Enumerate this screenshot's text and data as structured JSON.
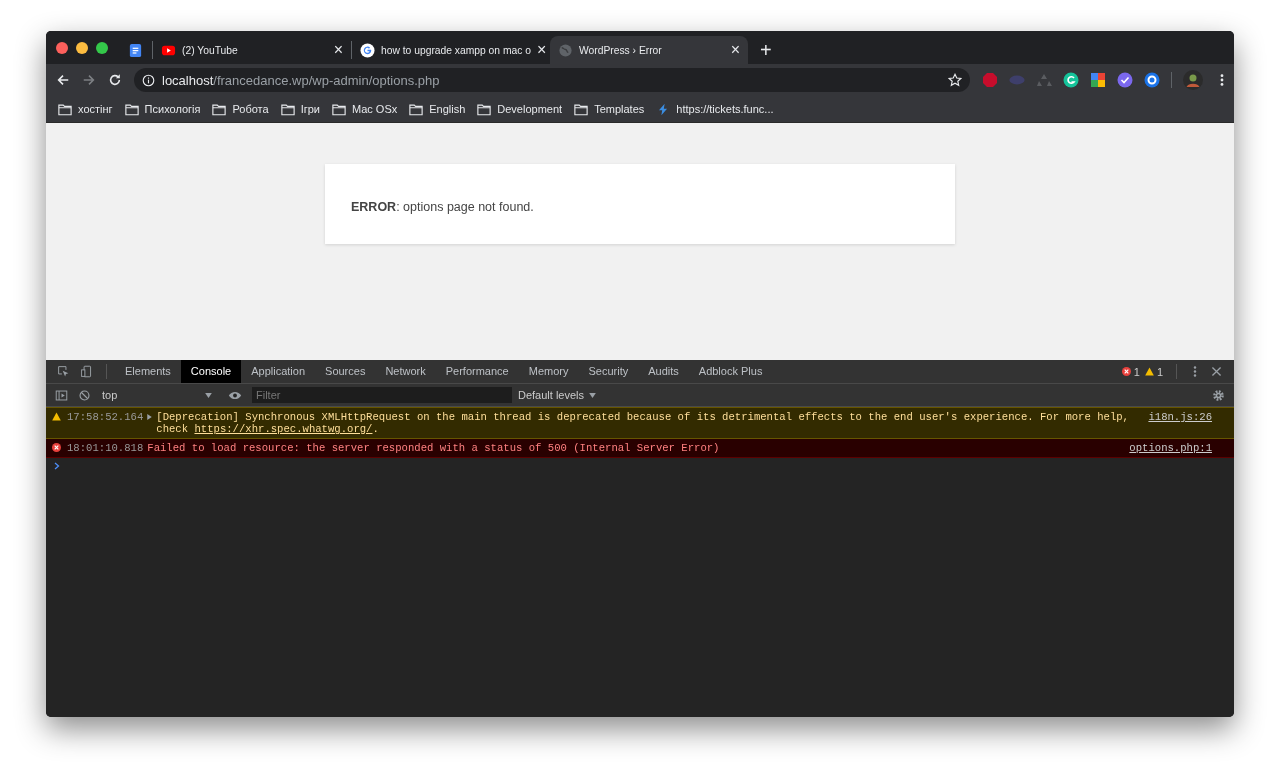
{
  "browser": {
    "tabs": [
      {
        "kind": "docs",
        "pinned": true,
        "selected": false
      },
      {
        "kind": "youtube",
        "pinned": false,
        "title": "(2) YouTube",
        "close": "×",
        "selected": false
      },
      {
        "kind": "google",
        "pinned": false,
        "title": "how to upgrade xampp on mac o",
        "close": "×",
        "selected": false
      },
      {
        "kind": "globe",
        "pinned": false,
        "title": "WordPress › Error",
        "close": "×",
        "selected": true
      }
    ],
    "new_tab": "+",
    "address": {
      "host": "localhost",
      "path": "/francedance.wp/wp-admin/options.php"
    },
    "bookmarks": [
      {
        "kind": "folder",
        "label": "хостінг"
      },
      {
        "kind": "folder",
        "label": "Психологія"
      },
      {
        "kind": "folder",
        "label": "Робота"
      },
      {
        "kind": "folder",
        "label": "Ігри"
      },
      {
        "kind": "folder",
        "label": "Mac OSx"
      },
      {
        "kind": "folder",
        "label": "English"
      },
      {
        "kind": "folder",
        "label": "Development"
      },
      {
        "kind": "folder",
        "label": "Templates"
      },
      {
        "kind": "link",
        "label": "https://tickets.func..."
      }
    ]
  },
  "page": {
    "message": "**ERROR**: options page not found."
  },
  "devtools": {
    "tabs": [
      {
        "label": "Elements",
        "selected": false
      },
      {
        "label": "Console",
        "selected": true
      },
      {
        "label": "Application",
        "selected": false
      },
      {
        "label": "Sources",
        "selected": false
      },
      {
        "label": "Network",
        "selected": false
      },
      {
        "label": "Performance",
        "selected": false
      },
      {
        "label": "Memory",
        "selected": false
      },
      {
        "label": "Security",
        "selected": false
      },
      {
        "label": "Audits",
        "selected": false
      },
      {
        "label": "Adblock Plus",
        "selected": false
      }
    ],
    "error_count": "1",
    "warning_count": "1",
    "context": "top",
    "filter": {
      "placeholder": "Filter"
    },
    "levels": "Default levels",
    "messages": [
      {
        "kind": "warning",
        "time": "17:58:52.164",
        "expandable": true,
        "text": "[Deprecation] Synchronous XMLHttpRequest on the main thread is deprecated because of its detrimental effects to the end user's experience. For more help, check ",
        "link": "https://xhr.spec.whatwg.org/",
        "after": ".",
        "source": "i18n.js:26"
      },
      {
        "kind": "error",
        "time": "18:01:10.818",
        "expandable": false,
        "text": "Failed to load resource: the server responded with a status of 500 (Internal Server Error)",
        "source": "options.php:1"
      }
    ]
  }
}
